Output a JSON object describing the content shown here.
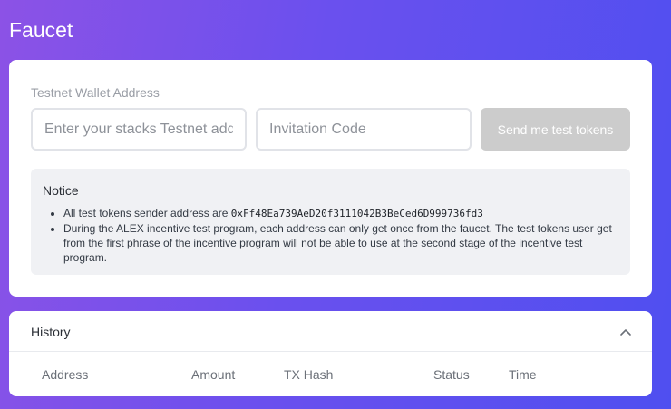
{
  "page": {
    "title": "Faucet"
  },
  "faucet": {
    "field_label": "Testnet Wallet Address",
    "address_placeholder": "Enter your stacks Testnet address",
    "address_value": "",
    "code_placeholder": "Invitation Code",
    "code_value": "",
    "send_label": "Send me test tokens"
  },
  "notice": {
    "title": "Notice",
    "item1_prefix": "All test tokens sender address are ",
    "item1_address": "0xFf48Ea739AeD20f3111042B3BeCed6D999736fd3",
    "item2": "During the ALEX incentive test program, each address can only get once from the faucet. The test tokens user get from the first phrase of the incentive program will not be able to use at the second stage of the incentive test program."
  },
  "history": {
    "title": "History",
    "columns": [
      "Address",
      "Amount",
      "TX Hash",
      "Status",
      "Time"
    ],
    "expanded": true
  },
  "colors": {
    "gradient_start": "#8c52e6",
    "gradient_end": "#4f4ff0",
    "button_disabled": "#cccccc"
  },
  "icons": {
    "collapse": "chevron-up-icon"
  }
}
